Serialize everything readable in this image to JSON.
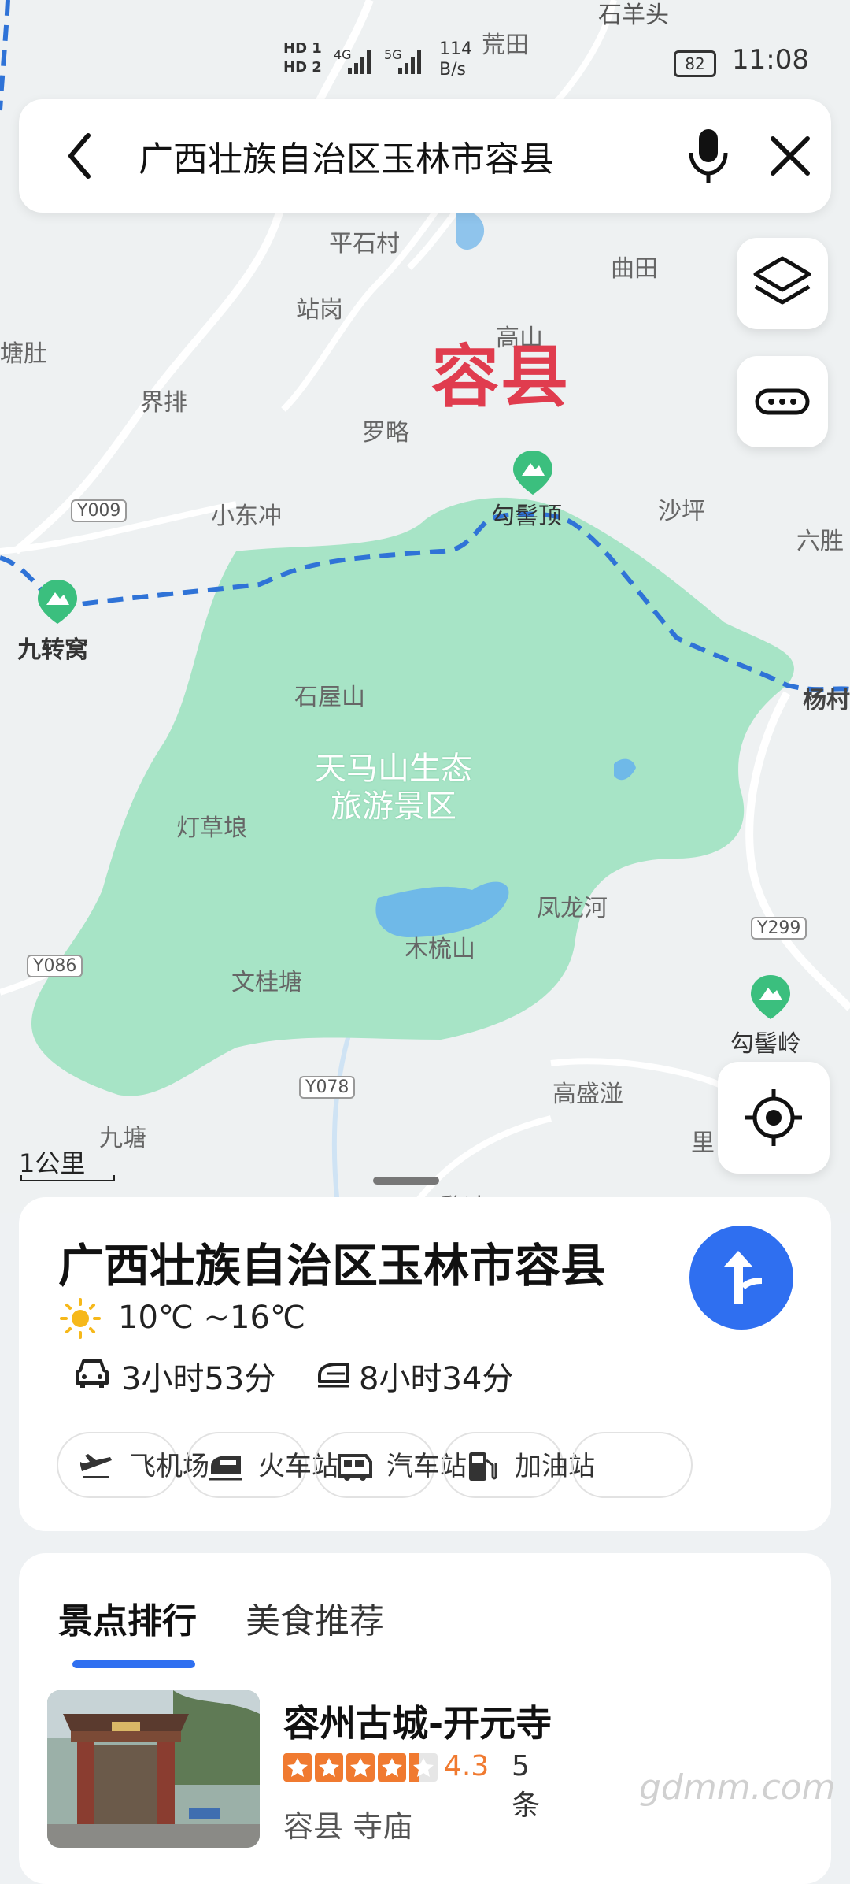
{
  "status_bar": {
    "hd1": "HD 1",
    "hd2": "HD 2",
    "net1": "4G",
    "net2": "5G",
    "speed_value": "114",
    "speed_unit": "B/s",
    "battery": "82",
    "time": "11:08"
  },
  "search": {
    "query": "广西壮族自治区玉林市容县"
  },
  "map": {
    "county_label": "容县",
    "scenic_area_line1": "天马山生态",
    "scenic_area_line2": "旅游景区",
    "scale": "1公里",
    "places": [
      "石羊头",
      "荒田",
      "平石村",
      "曲田",
      "站岗",
      "高山",
      "塘肚",
      "界排",
      "罗略",
      "小东冲",
      "沙坪",
      "六胜",
      "石屋山",
      "灯草埌",
      "凤龙河",
      "木梳山",
      "文桂塘",
      "高盛湴",
      "九塘",
      "里",
      "黎冲",
      "杨村"
    ],
    "pois": [
      "勾髻顶",
      "九转窝",
      "勾髻岭"
    ],
    "roads": [
      "Y009",
      "Y086",
      "Y078",
      "Y299"
    ]
  },
  "info_card": {
    "title": "广西壮族自治区玉林市容县",
    "weather": "10℃ ~16℃",
    "drive_time": "3小时53分",
    "train_time": "8小时34分",
    "chips": [
      "飞机场",
      "火车站",
      "汽车站",
      "加油站"
    ]
  },
  "rank_card": {
    "tabs": [
      "景点排行",
      "美食推荐"
    ],
    "place": {
      "name": "容州古城-开元寺",
      "rating": "4.3",
      "rating_value": 4.3,
      "reviews": "5条",
      "tags": "容县  寺庙"
    }
  },
  "watermark": "gdmm.com",
  "colors": {
    "accent": "#2f6ff0",
    "scenic": "#a7e4c6",
    "county_label": "#e03c4e",
    "rating": "#f07a30"
  }
}
